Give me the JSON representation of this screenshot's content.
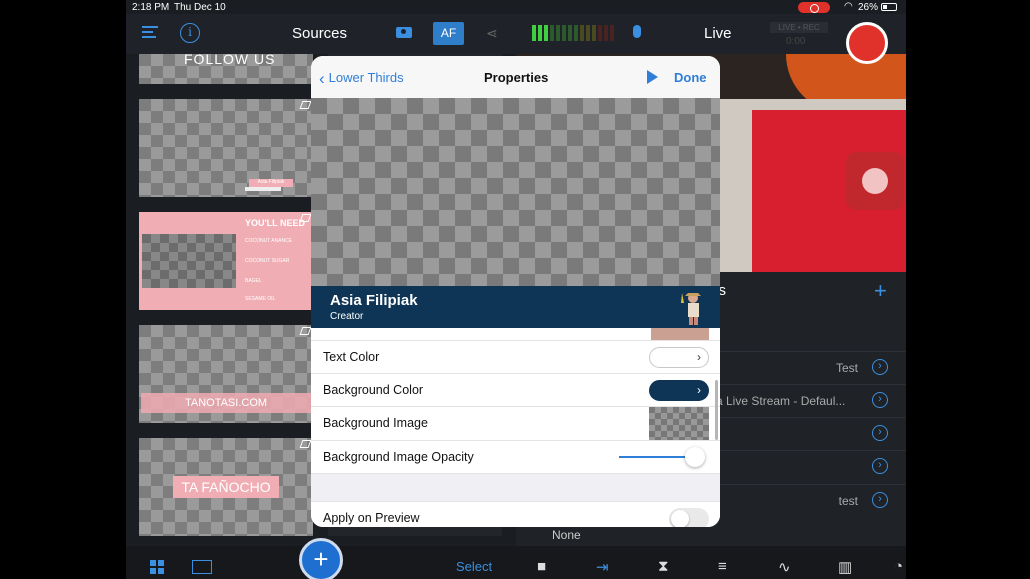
{
  "status_bar": {
    "time": "2:18 PM",
    "date": "Thu Dec 10",
    "battery": "26%"
  },
  "toolbar": {
    "sources_title": "Sources",
    "af_label": "AF",
    "live_label": "Live",
    "live_badge": "LIVE • REC",
    "timer": "0:00"
  },
  "sources": {
    "items": [
      {
        "caption": "FOLLOW US"
      },
      {
        "caption": "Asia Filipiak"
      },
      {
        "title": "YOU'LL NEED",
        "lines": [
          "COCONUT ANANCE",
          "COCONUT SUGAR",
          "BAGEL",
          "SESAME OIL"
        ]
      },
      {
        "caption": "TANOTASI.COM"
      },
      {
        "caption": "TA FAÑOCHO"
      }
    ]
  },
  "outputs": {
    "title_fragment": "uts",
    "rows": [
      {
        "label": "",
        "value": "Test"
      },
      {
        "label": "a Live Stream - Defaul...",
        "value": ""
      },
      {
        "label": "",
        "value": ""
      },
      {
        "label": "",
        "value": ""
      },
      {
        "label": "",
        "value": "test"
      }
    ],
    "none_label": "None"
  },
  "bottom_bar": {
    "select_label": "Select"
  },
  "modal": {
    "back_label": "Lower Thirds",
    "title": "Properties",
    "done_label": "Done",
    "lower_third": {
      "name": "Asia Filipiak",
      "role": "Creator"
    },
    "rows": {
      "text_color": "Text Color",
      "background_color": "Background Color",
      "background_image": "Background Image",
      "background_image_opacity": "Background Image Opacity",
      "apply_on_preview": "Apply on Preview"
    },
    "opacity_value": 1.0,
    "apply_on_preview_on": false,
    "colors": {
      "text": "#ffffff",
      "background": "#0e3556"
    }
  }
}
